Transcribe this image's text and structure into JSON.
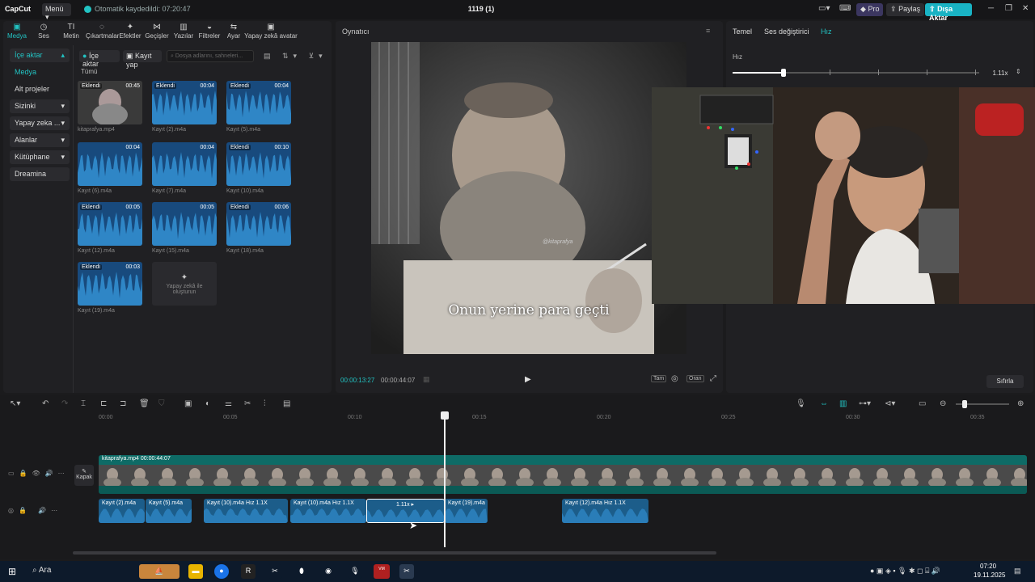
{
  "topbar": {
    "logo": "CapCut",
    "menu_label": "Menü",
    "autosave": "Otomatik kaydedildi: 07:20:47",
    "project_title": "1119 (1)",
    "pro_label": "Pro",
    "share_label": "Paylaş",
    "export_label": "Dışa Aktar"
  },
  "tool_tabs": [
    {
      "label": "Medya",
      "icon": "media-icon"
    },
    {
      "label": "Ses",
      "icon": "audio-icon"
    },
    {
      "label": "Metin",
      "icon": "text-icon"
    },
    {
      "label": "Çıkartmalar",
      "icon": "sticker-icon"
    },
    {
      "label": "Efektler",
      "icon": "effects-icon"
    },
    {
      "label": "Geçişler",
      "icon": "transitions-icon"
    },
    {
      "label": "Yazılar",
      "icon": "captions-icon"
    },
    {
      "label": "Filtreler",
      "icon": "filters-icon"
    },
    {
      "label": "Ayar",
      "icon": "adjust-icon"
    },
    {
      "label": "Yapay zekâ avatar",
      "icon": "ai-avatar-icon"
    }
  ],
  "side_nav": [
    {
      "label": "İçe aktar",
      "chevron": "▴"
    },
    {
      "label": "Medya",
      "chevron": ""
    },
    {
      "label": "Alt projeler",
      "chevron": ""
    },
    {
      "label": "Sizinki",
      "chevron": "▾"
    },
    {
      "label": "Yapay zeka ...",
      "chevron": "▾"
    },
    {
      "label": "Alanlar",
      "chevron": "▾"
    },
    {
      "label": "Kütüphane",
      "chevron": "▾"
    },
    {
      "label": "Dreamina",
      "chevron": ""
    }
  ],
  "media_toolbar": {
    "import_label": "İçe aktar",
    "record_label": "Kayıt yap",
    "search_placeholder": "Dosya adlarını, sahneleri...",
    "all_label": "Tümü"
  },
  "media_items": [
    {
      "name": "kitaprafya.mp4",
      "badge": "Eklendi",
      "duration": "00:45",
      "video": true
    },
    {
      "name": "Kayıt (2).m4a",
      "badge": "Eklendi",
      "duration": "00:04"
    },
    {
      "name": "Kayıt (5).m4a",
      "badge": "Eklendi",
      "duration": "00:04"
    },
    {
      "name": "Kayıt (6).m4a",
      "badge": "",
      "duration": "00:04"
    },
    {
      "name": "Kayıt (7).m4a",
      "badge": "",
      "duration": "00:04"
    },
    {
      "name": "Kayıt (10).m4a",
      "badge": "Eklendi",
      "duration": "00:10"
    },
    {
      "name": "Kayıt (12).m4a",
      "badge": "Eklendi",
      "duration": "00:05"
    },
    {
      "name": "Kayıt (15).m4a",
      "badge": "",
      "duration": "00:05"
    },
    {
      "name": "Kayıt (18).m4a",
      "badge": "Eklendi",
      "duration": "00:06"
    },
    {
      "name": "Kayıt (19).m4a",
      "badge": "Eklendi",
      "duration": "00:03"
    }
  ],
  "ai_card_label": "Yapay zekâ ile oluşturun",
  "player": {
    "title": "Oynatıcı",
    "subtitle": "Onun yerine para geçti",
    "watermark": "@kitaprafya",
    "time_current": "00:00:13:27",
    "time_total": "00:00:44:07",
    "full_label": "Tam",
    "ratio_label": "Oran"
  },
  "right_panel": {
    "tabs": [
      "Temel",
      "Ses değiştirici",
      "Hız"
    ],
    "active_tab": "Hız",
    "speed_label": "Hız",
    "speed_value": "1.11x",
    "reset_label": "Sıfırla"
  },
  "timeline": {
    "ruler_labels": [
      "00:00",
      "00:05",
      "00:10",
      "00:15",
      "00:20",
      "00:25",
      "00:30",
      "00:35"
    ],
    "cover_label": "Kapak",
    "video_track_label": "kitaprafya.mp4   00:00:44:07",
    "audio_clips": [
      {
        "label": "Kayıt (2).m4a",
        "speed": ""
      },
      {
        "label": "Kayıt (5).m4a",
        "speed": ""
      },
      {
        "label": "Kayıt (10).m4a",
        "speed": "Hız 1.1X"
      },
      {
        "label": "Kayıt (10).m4a",
        "speed": "Hız 1.1X"
      },
      {
        "label": "",
        "speed": "1.11x ▸"
      },
      {
        "label": "Kayıt (19).m4a",
        "speed": ""
      },
      {
        "label": "Kayıt (12).m4a",
        "speed": "Hız 1.1X"
      }
    ]
  },
  "taskbar": {
    "search_label": "Ara",
    "time": "07:20",
    "date": "19.11.2025"
  },
  "colors": {
    "accent": "#22c3c3",
    "export": "#19b3c4",
    "audio_clip": "#1c5d8a",
    "video_track": "#0e6b66"
  }
}
